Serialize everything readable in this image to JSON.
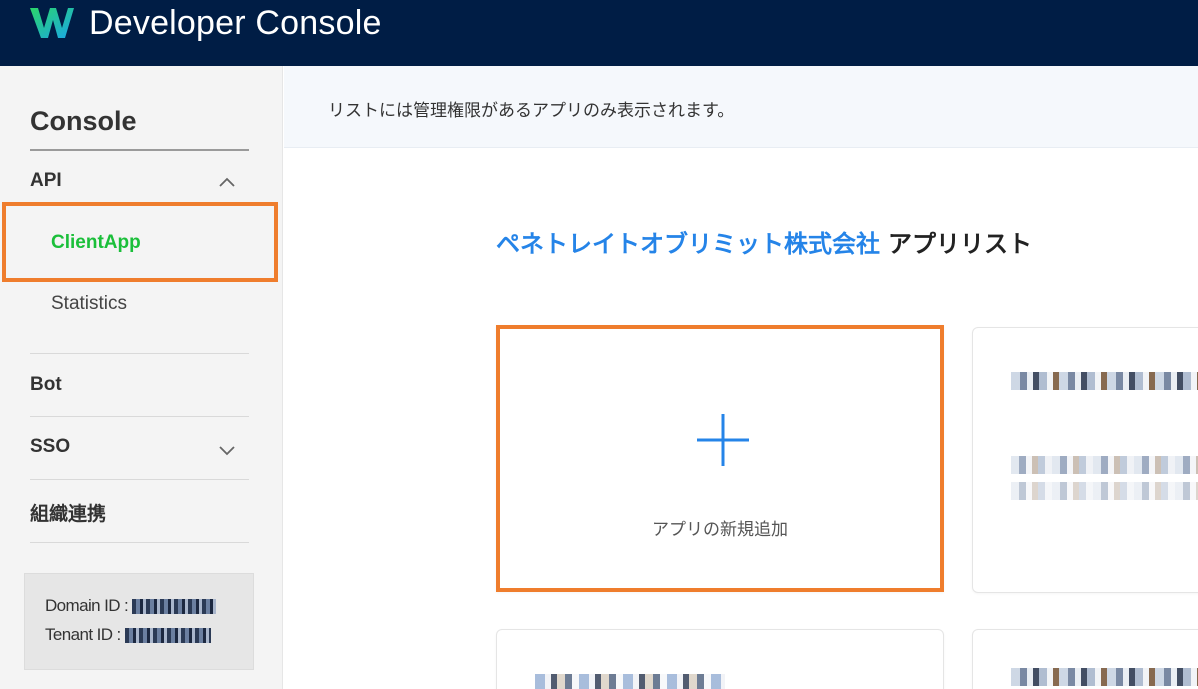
{
  "header": {
    "title": "Developer Console",
    "logo_icon": "w-logo-icon",
    "background": "#001d45"
  },
  "sidebar": {
    "heading": "Console",
    "sections": [
      {
        "label": "API",
        "expanded": true,
        "children": [
          {
            "label": "ClientApp",
            "active": true
          },
          {
            "label": "Statistics",
            "active": false
          }
        ]
      },
      {
        "label": "Bot"
      },
      {
        "label": "SSO",
        "expanded": false
      },
      {
        "label": "組織連携"
      }
    ],
    "ids": {
      "domain_label": "Domain ID :",
      "tenant_label": "Tenant ID :"
    },
    "active_color": "#1bbf3a"
  },
  "main": {
    "notice": "リストには管理権限があるアプリのみ表示されます。",
    "company_name": "ペネトレイトオブリミット株式会社",
    "list_suffix": "アプリリスト",
    "add_card_label": "アプリの新規追加",
    "accent_color": "#2584e8",
    "highlight_color": "#ef7d2d"
  }
}
